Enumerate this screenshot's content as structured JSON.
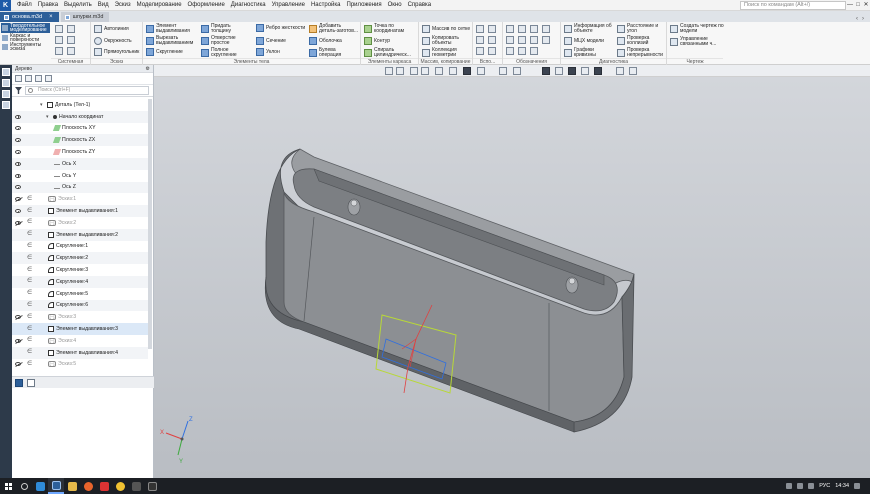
{
  "app": {
    "logo_letter": "K",
    "menu": [
      "Файл",
      "Правка",
      "Выделить",
      "Вид",
      "Эскиз",
      "Моделирование",
      "Оформление",
      "Диагностика",
      "Управление",
      "Настройка",
      "Приложения",
      "Окно",
      "Справка"
    ],
    "search_placeholder": "Поиск по командам (Alt+/)",
    "window_controls": [
      "—",
      "□",
      "✕"
    ]
  },
  "tabs": [
    {
      "label": "основа.m3d",
      "active": true
    },
    {
      "label": "шпурки.m3d",
      "active": false
    }
  ],
  "modes": [
    {
      "label": "Твердотельное моделирование",
      "active": true
    },
    {
      "label": "Каркас и поверхности",
      "active": false
    },
    {
      "label": "Инструменты эскиза",
      "active": false
    }
  ],
  "ribbon": {
    "group_labels": [
      "Системная",
      "Эскиз",
      "Элементы тела",
      "Элементы каркаса",
      "Массив, копирование",
      "Вспо...",
      "Обозначения",
      "Диагностика",
      "Чертеж"
    ],
    "sketch_items": [
      "Автолиния",
      "Окружность",
      "Прямоугольник"
    ],
    "body_items_1": [
      "Элемент выдавливания",
      "Вырезать выдавливанием",
      "Скругление"
    ],
    "body_items_2": [
      "Придать толщину",
      "Отверстие простое",
      "Полное скругление"
    ],
    "body_items_3": [
      "Ребро жесткости",
      "Сечение",
      "Уклон"
    ],
    "body_items_4": [
      "Добавить деталь-заготов...",
      "Оболочка",
      "Булева операция"
    ],
    "frame_items": [
      "Точка по координатам",
      "Контур",
      "Спираль цилиндрическ..."
    ],
    "array_items": [
      "Массив по сетке",
      "Копировать объекты",
      "Коллекция геометрии"
    ],
    "diag_items": [
      "Информация об объекте",
      "МЦХ модели",
      "Графики кривизны"
    ],
    "diag_items_2": [
      "Расстояние и угол",
      "Проверка коллизий",
      "Проверка непрерывности"
    ],
    "drawing_items": [
      "Создать чертеж по модели",
      "Управление связанными ч..."
    ]
  },
  "tree": {
    "panel_title": "Дерево",
    "filter_placeholder": "Поиск (Ctrl+F)",
    "rows": [
      {
        "label": "Деталь (Тел-1)",
        "icon": "body",
        "indent": 28,
        "eye": "none",
        "c": false,
        "dim": false,
        "expander": "▾"
      },
      {
        "label": "Начало координат",
        "icon": "origin",
        "indent": 34,
        "eye": "open",
        "c": false,
        "dim": false,
        "expander": "▾"
      },
      {
        "label": "Плоскость XY",
        "icon": "plane-xy",
        "indent": 42,
        "eye": "open",
        "c": false,
        "dim": false,
        "expander": ""
      },
      {
        "label": "Плоскость ZX",
        "icon": "plane-zx",
        "indent": 42,
        "eye": "open",
        "c": false,
        "dim": false,
        "expander": ""
      },
      {
        "label": "Плоскость ZY",
        "icon": "plane-zy",
        "indent": 42,
        "eye": "open",
        "c": false,
        "dim": false,
        "expander": ""
      },
      {
        "label": "Ось X",
        "icon": "axis",
        "indent": 42,
        "eye": "open",
        "c": false,
        "dim": false,
        "expander": ""
      },
      {
        "label": "Ось Y",
        "icon": "axis",
        "indent": 42,
        "eye": "open",
        "c": false,
        "dim": false,
        "expander": ""
      },
      {
        "label": "Ось Z",
        "icon": "axis",
        "indent": 42,
        "eye": "open",
        "c": false,
        "dim": false,
        "expander": ""
      },
      {
        "label": "Эскиз:1",
        "icon": "sketch",
        "indent": 36,
        "eye": "crossed",
        "c": true,
        "dim": true,
        "expander": ""
      },
      {
        "label": "Элемент выдавливания:1",
        "icon": "extrude",
        "indent": 36,
        "eye": "open",
        "c": true,
        "dim": false,
        "expander": ""
      },
      {
        "label": "Эскиз:2",
        "icon": "sketch",
        "indent": 36,
        "eye": "crossed",
        "c": true,
        "dim": true,
        "expander": ""
      },
      {
        "label": "Элемент выдавливания:2",
        "icon": "extrude",
        "indent": 36,
        "eye": "none",
        "c": true,
        "dim": false,
        "expander": ""
      },
      {
        "label": "Скругление:1",
        "icon": "fillet",
        "indent": 36,
        "eye": "none",
        "c": true,
        "dim": false,
        "expander": ""
      },
      {
        "label": "Скругление:2",
        "icon": "fillet",
        "indent": 36,
        "eye": "none",
        "c": true,
        "dim": false,
        "expander": ""
      },
      {
        "label": "Скругление:3",
        "icon": "fillet",
        "indent": 36,
        "eye": "none",
        "c": true,
        "dim": false,
        "expander": ""
      },
      {
        "label": "Скругление:4",
        "icon": "fillet",
        "indent": 36,
        "eye": "none",
        "c": true,
        "dim": false,
        "expander": ""
      },
      {
        "label": "Скругление:5",
        "icon": "fillet",
        "indent": 36,
        "eye": "none",
        "c": true,
        "dim": false,
        "expander": ""
      },
      {
        "label": "Скругление:6",
        "icon": "fillet",
        "indent": 36,
        "eye": "none",
        "c": true,
        "dim": false,
        "expander": ""
      },
      {
        "label": "Эскиз:3",
        "icon": "sketch",
        "indent": 36,
        "eye": "crossed",
        "c": true,
        "dim": true,
        "expander": ""
      },
      {
        "label": "Элемент выдавливания:3",
        "icon": "extrude",
        "indent": 36,
        "eye": "none",
        "c": true,
        "dim": false,
        "expander": "",
        "selected": true
      },
      {
        "label": "Эскиз:4",
        "icon": "sketch",
        "indent": 36,
        "eye": "crossed",
        "c": true,
        "dim": true,
        "expander": ""
      },
      {
        "label": "Элемент выдавливания:4",
        "icon": "extrude",
        "indent": 36,
        "eye": "none",
        "c": true,
        "dim": false,
        "expander": ""
      },
      {
        "label": "Эскиз:5",
        "icon": "sketch",
        "indent": 36,
        "eye": "crossed",
        "c": true,
        "dim": true,
        "expander": ""
      }
    ]
  },
  "axes_triad": {
    "x": "X",
    "y": "Y",
    "z": "Z"
  },
  "taskbar": {
    "tray_lang": "РУС",
    "clock": "14:34"
  },
  "colors": {
    "accent": "#2d5f99",
    "model_face": "#8c8f93",
    "model_dark": "#5f6266",
    "sketch_green": "#b8d838",
    "axis_blue": "#2f6fe0",
    "axis_red": "#e04040"
  }
}
